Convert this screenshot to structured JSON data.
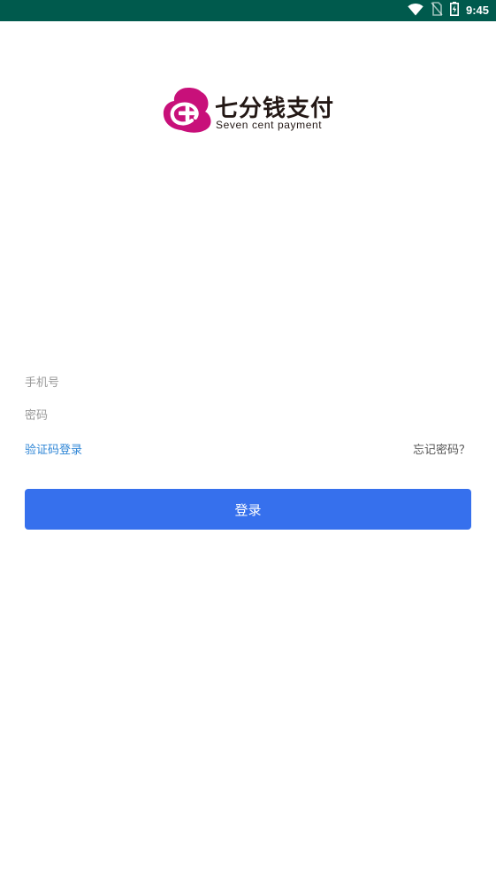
{
  "status_bar": {
    "time": "9:45",
    "icons": [
      "wifi-icon",
      "no-sim-icon",
      "battery-charging-icon"
    ],
    "background": "#005a4d"
  },
  "logo": {
    "title": "七分钱支付",
    "subtitle": "Seven cent payment",
    "icon": "seven-cent-logo-icon",
    "color": "#c8107a"
  },
  "form": {
    "phone_placeholder": "手机号",
    "password_placeholder": "密码",
    "sms_login_label": "验证码登录",
    "forgot_password_label": "忘记密码？",
    "login_button_label": "登录"
  },
  "colors": {
    "primary_button": "#3670ed",
    "link": "#2f86d6"
  }
}
